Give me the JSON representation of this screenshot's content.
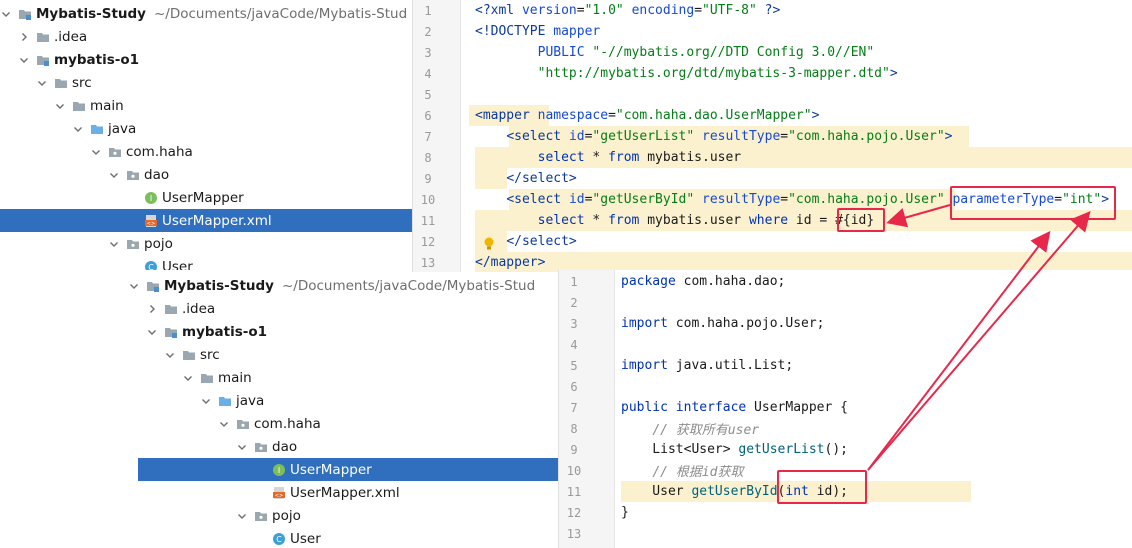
{
  "top_tree": {
    "project_name": "Mybatis-Study",
    "project_path": "~/Documents/javaCode/Mybatis-Stud",
    "items": [
      {
        "label": "Mybatis-Study",
        "path": "~/Documents/javaCode/Mybatis-Stud",
        "icon": "folder-module-icon",
        "depth": 0,
        "expanded": true,
        "bold": true
      },
      {
        "label": ".idea",
        "icon": "folder-icon",
        "depth": 1,
        "expanded": false
      },
      {
        "label": "mybatis-o1",
        "icon": "folder-module-icon",
        "depth": 1,
        "expanded": true,
        "bold": true
      },
      {
        "label": "src",
        "icon": "folder-icon",
        "depth": 2,
        "expanded": true
      },
      {
        "label": "main",
        "icon": "folder-icon",
        "depth": 3,
        "expanded": true
      },
      {
        "label": "java",
        "icon": "folder-source-icon",
        "depth": 4,
        "expanded": true
      },
      {
        "label": "com.haha",
        "icon": "package-icon",
        "depth": 5,
        "expanded": true
      },
      {
        "label": "dao",
        "icon": "package-icon",
        "depth": 6,
        "expanded": true
      },
      {
        "label": "UserMapper",
        "icon": "interface-icon",
        "depth": 7,
        "leaf": true
      },
      {
        "label": "UserMapper.xml",
        "icon": "xml-file-icon",
        "depth": 7,
        "leaf": true,
        "selected": true
      },
      {
        "label": "pojo",
        "icon": "package-icon",
        "depth": 6,
        "expanded": true
      },
      {
        "label": "User",
        "icon": "class-icon",
        "depth": 7,
        "leaf": true
      }
    ]
  },
  "bottom_tree": {
    "items": [
      {
        "label": "Mybatis-Study",
        "path": "~/Documents/javaCode/Mybatis-Stud",
        "icon": "folder-module-icon",
        "depth": 0,
        "expanded": true,
        "bold": true
      },
      {
        "label": ".idea",
        "icon": "folder-icon",
        "depth": 1,
        "expanded": false
      },
      {
        "label": "mybatis-o1",
        "icon": "folder-module-icon",
        "depth": 1,
        "expanded": true,
        "bold": true
      },
      {
        "label": "src",
        "icon": "folder-icon",
        "depth": 2,
        "expanded": true
      },
      {
        "label": "main",
        "icon": "folder-icon",
        "depth": 3,
        "expanded": true
      },
      {
        "label": "java",
        "icon": "folder-source-icon",
        "depth": 4,
        "expanded": true
      },
      {
        "label": "com.haha",
        "icon": "package-icon",
        "depth": 5,
        "expanded": true
      },
      {
        "label": "dao",
        "icon": "package-icon",
        "depth": 6,
        "expanded": true
      },
      {
        "label": "UserMapper",
        "icon": "interface-icon",
        "depth": 7,
        "leaf": true,
        "selected": true
      },
      {
        "label": "UserMapper.xml",
        "icon": "xml-file-icon",
        "depth": 7,
        "leaf": true
      },
      {
        "label": "pojo",
        "icon": "package-icon",
        "depth": 6,
        "expanded": true
      },
      {
        "label": "User",
        "icon": "class-icon",
        "depth": 7,
        "leaf": true
      }
    ]
  },
  "xml_editor": {
    "lines": [
      {
        "n": "1",
        "tokens": [
          [
            "tag",
            "<?xml "
          ],
          [
            "attr",
            "version"
          ],
          [
            "plain",
            "="
          ],
          [
            "str",
            "\"1.0\""
          ],
          [
            "plain",
            " "
          ],
          [
            "attr",
            "encoding"
          ],
          [
            "plain",
            "="
          ],
          [
            "str",
            "\"UTF-8\""
          ],
          [
            "tag",
            " ?>"
          ]
        ]
      },
      {
        "n": "2",
        "tokens": [
          [
            "tag",
            "<!DOCTYPE "
          ],
          [
            "attr",
            "mapper"
          ]
        ]
      },
      {
        "n": "3",
        "tokens": [
          [
            "plain",
            "        "
          ],
          [
            "attr",
            "PUBLIC "
          ],
          [
            "str",
            "\"-//mybatis.org//DTD Config 3.0//EN\""
          ]
        ]
      },
      {
        "n": "4",
        "tokens": [
          [
            "plain",
            "        "
          ],
          [
            "str",
            "\"http://mybatis.org/dtd/mybatis-3-mapper.dtd\""
          ],
          [
            "tag",
            ">"
          ]
        ]
      },
      {
        "n": "5",
        "tokens": []
      },
      {
        "n": "6",
        "tokens": [
          [
            "tag",
            "<mapper "
          ],
          [
            "attr",
            "namespace"
          ],
          [
            "plain",
            "="
          ],
          [
            "str",
            "\"com.haha.dao.UserMapper\""
          ],
          [
            "tag",
            ">"
          ]
        ]
      },
      {
        "n": "7",
        "tokens": [
          [
            "plain",
            "    "
          ],
          [
            "tag",
            "<select "
          ],
          [
            "attr",
            "id"
          ],
          [
            "plain",
            "="
          ],
          [
            "str",
            "\"getUserList\""
          ],
          [
            "plain",
            " "
          ],
          [
            "attr",
            "resultType"
          ],
          [
            "plain",
            "="
          ],
          [
            "str",
            "\"com.haha.pojo.User\""
          ],
          [
            "tag",
            ">"
          ]
        ]
      },
      {
        "n": "8",
        "tokens": [
          [
            "plain",
            "        "
          ],
          [
            "kw",
            "select"
          ],
          [
            "plain",
            " * "
          ],
          [
            "kw",
            "from"
          ],
          [
            "plain",
            " mybatis.user"
          ]
        ]
      },
      {
        "n": "9",
        "tokens": [
          [
            "plain",
            "    "
          ],
          [
            "tag",
            "</select>"
          ]
        ]
      },
      {
        "n": "10",
        "tokens": [
          [
            "plain",
            "    "
          ],
          [
            "tag",
            "<select "
          ],
          [
            "attr",
            "id"
          ],
          [
            "plain",
            "="
          ],
          [
            "str",
            "\"getUserById\""
          ],
          [
            "plain",
            " "
          ],
          [
            "attr",
            "resultType"
          ],
          [
            "plain",
            "="
          ],
          [
            "str",
            "\"com.haha.pojo.User\""
          ],
          [
            "plain",
            " "
          ],
          [
            "attr",
            "parameterType"
          ],
          [
            "plain",
            "="
          ],
          [
            "str",
            "\"int\""
          ],
          [
            "tag",
            ">"
          ]
        ]
      },
      {
        "n": "11",
        "tokens": [
          [
            "plain",
            "        "
          ],
          [
            "kw",
            "select"
          ],
          [
            "plain",
            " * "
          ],
          [
            "kw",
            "from"
          ],
          [
            "plain",
            " mybatis.user "
          ],
          [
            "kw",
            "where"
          ],
          [
            "plain",
            " id = #{id}"
          ]
        ]
      },
      {
        "n": "12",
        "tokens": [
          [
            "plain",
            "    "
          ],
          [
            "tag",
            "</select>"
          ]
        ]
      },
      {
        "n": "13",
        "tokens": [
          [
            "tag",
            "</mapper>"
          ]
        ]
      }
    ]
  },
  "java_editor": {
    "lines": [
      {
        "n": "1",
        "tokens": [
          [
            "kw",
            "package"
          ],
          [
            "plain",
            " com.haha.dao;"
          ]
        ]
      },
      {
        "n": "2",
        "tokens": []
      },
      {
        "n": "3",
        "tokens": [
          [
            "kw",
            "import"
          ],
          [
            "plain",
            " com.haha.pojo.User;"
          ]
        ]
      },
      {
        "n": "4",
        "tokens": []
      },
      {
        "n": "5",
        "tokens": [
          [
            "kw",
            "import"
          ],
          [
            "plain",
            " java.util.List;"
          ]
        ]
      },
      {
        "n": "6",
        "tokens": []
      },
      {
        "n": "7",
        "tokens": [
          [
            "kw",
            "public interface"
          ],
          [
            "plain",
            " UserMapper {"
          ]
        ]
      },
      {
        "n": "8",
        "tokens": [
          [
            "plain",
            "    "
          ],
          [
            "cmt",
            "// 获取所有user"
          ]
        ]
      },
      {
        "n": "9",
        "tokens": [
          [
            "plain",
            "    List<User> "
          ],
          [
            "fn",
            "getUserList"
          ],
          [
            "plain",
            "();"
          ]
        ]
      },
      {
        "n": "10",
        "tokens": [
          [
            "plain",
            "    "
          ],
          [
            "cmt",
            "// 根据id获取"
          ]
        ]
      },
      {
        "n": "11",
        "tokens": [
          [
            "plain",
            "    User "
          ],
          [
            "fn",
            "getUserById"
          ],
          [
            "plain",
            "("
          ],
          [
            "kw",
            "int"
          ],
          [
            "plain",
            " id);"
          ]
        ]
      },
      {
        "n": "12",
        "tokens": [
          [
            "plain",
            "}"
          ]
        ]
      },
      {
        "n": "13",
        "tokens": []
      }
    ]
  },
  "colors": {
    "selection": "#2f6fbd",
    "annotation_red": "#e8284b",
    "line_highlight": "#fbf1cf"
  }
}
